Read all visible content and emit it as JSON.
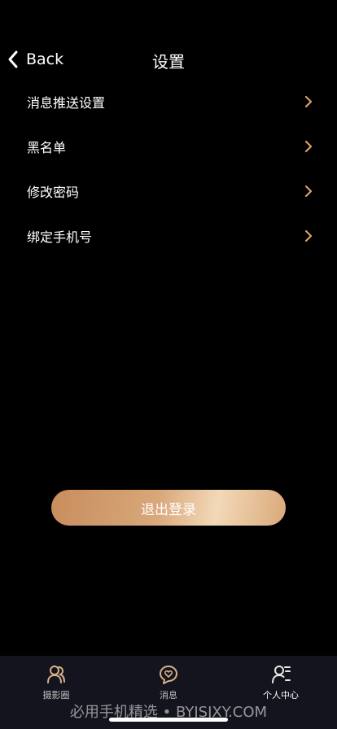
{
  "nav": {
    "back_label": "Back",
    "title": "设置"
  },
  "settings": {
    "items": [
      {
        "label": "消息推送设置",
        "icon": "chevron-right-icon"
      },
      {
        "label": "黑名单",
        "icon": "chevron-right-icon"
      },
      {
        "label": "修改密码",
        "icon": "chevron-right-icon"
      },
      {
        "label": "绑定手机号",
        "icon": "chevron-right-icon"
      }
    ]
  },
  "logout": {
    "label": "退出登录"
  },
  "tabbar": {
    "tabs": [
      {
        "label": "摄影圈",
        "icon": "people-icon",
        "active": false
      },
      {
        "label": "消息",
        "icon": "message-heart-icon",
        "active": false
      },
      {
        "label": "个人中心",
        "icon": "profile-icon",
        "active": true
      }
    ]
  },
  "watermark": {
    "text": "必用手机精选 • BYJSJXY.COM"
  },
  "colors": {
    "accent": "#d9a06a",
    "background": "#000000",
    "tabbar_bg": "#14141e",
    "inactive_icon": "#d6b08a"
  }
}
